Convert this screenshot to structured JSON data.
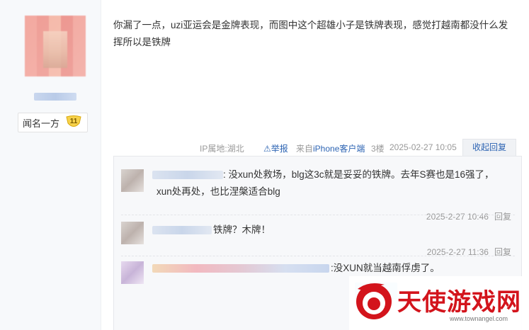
{
  "user": {
    "badge_name": "闻名一方",
    "badge_level": "11"
  },
  "post": {
    "content": "你漏了一点，uzi亚运会是金牌表现，而图中这个超雄小子是铁牌表现，感觉打越南都没什么发挥所以是铁牌",
    "tail": {
      "ip": "IP属地:湖北",
      "report": "举报",
      "from_prefix": "来自",
      "from_client": "iPhone客户端",
      "floor": "3楼",
      "time": "2025-02-27 10:05",
      "collapse": "收起回复"
    }
  },
  "replies": [
    {
      "text_line1": ": 没xun处救场，blg这3c就是妥妥的铁牌。去年S赛也是16强了，",
      "text_line2": "xun处再处，也比涅槃适合blg",
      "time": "2025-2-27 10:46",
      "reply": "回复"
    },
    {
      "text_line1": "铁牌？木牌！",
      "time": "2025-2-27 11:36",
      "reply": "回复"
    },
    {
      "text_line1": ":没XUN就当越南俘虏了。"
    }
  ],
  "watermark": {
    "text": "天使游戏网",
    "url": "www.townangel.com",
    "color": "#d3141c"
  },
  "colors": {
    "link": "#2d64b3",
    "meta": "#999999",
    "reply_bg": "#f7f8fa"
  }
}
